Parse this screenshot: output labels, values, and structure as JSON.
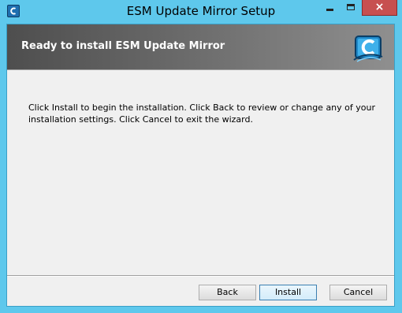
{
  "window": {
    "title": "ESM Update Mirror Setup",
    "close_glyph": "×"
  },
  "banner": {
    "title": "Ready to install ESM Update Mirror",
    "logo_icon": "esm-logo-icon"
  },
  "main": {
    "text": "Click Install to begin the installation. Click Back to review or change any of your installation settings. Click Cancel to exit the wizard."
  },
  "buttons": {
    "back": "Back",
    "install": "Install",
    "cancel": "Cancel"
  },
  "colors": {
    "titlebar": "#5ec8ec",
    "close_button": "#c75050",
    "banner_start": "#4e4e4e",
    "banner_end": "#8f8f8f",
    "dialog_background": "#f0f0f0"
  }
}
